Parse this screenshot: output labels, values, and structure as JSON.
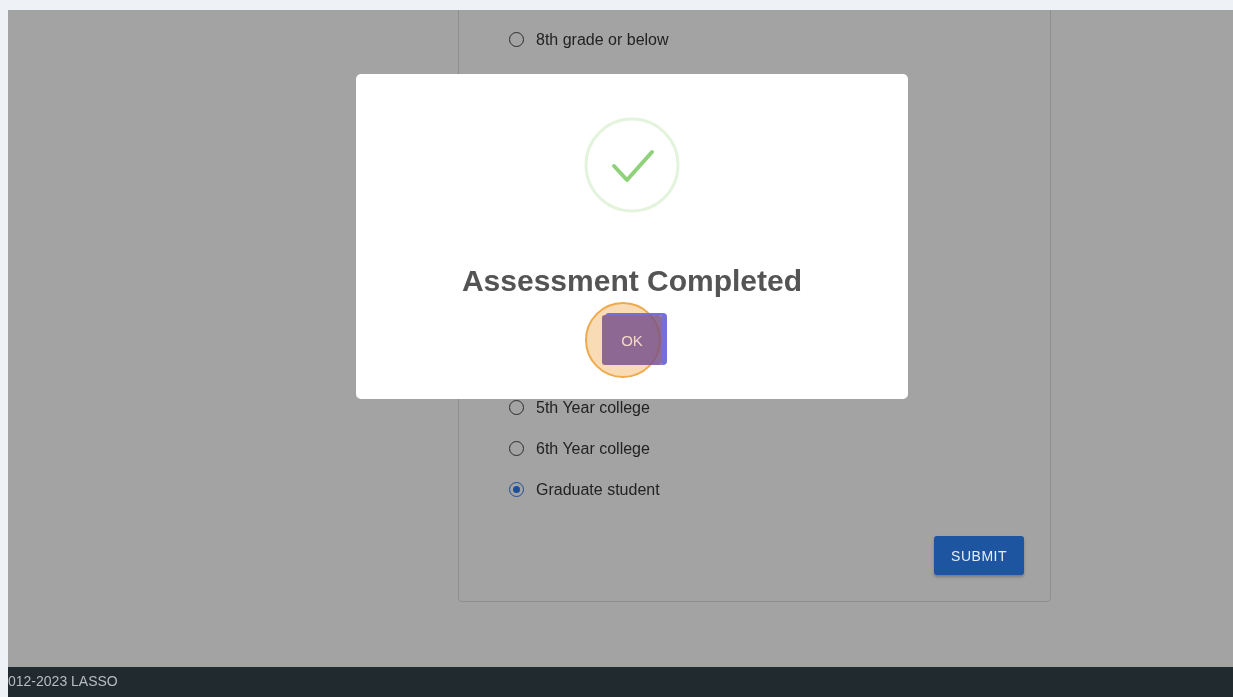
{
  "form": {
    "options": [
      {
        "label": "8th grade or below",
        "selected": false
      },
      {
        "label": "5th Year college",
        "selected": false
      },
      {
        "label": "6th Year college",
        "selected": false
      },
      {
        "label": "Graduate student",
        "selected": true
      }
    ],
    "submit": "SUBMIT"
  },
  "dialog": {
    "title": "Assessment Completed",
    "ok": "OK"
  },
  "footer": {
    "text": "012-2023 LASSO"
  }
}
